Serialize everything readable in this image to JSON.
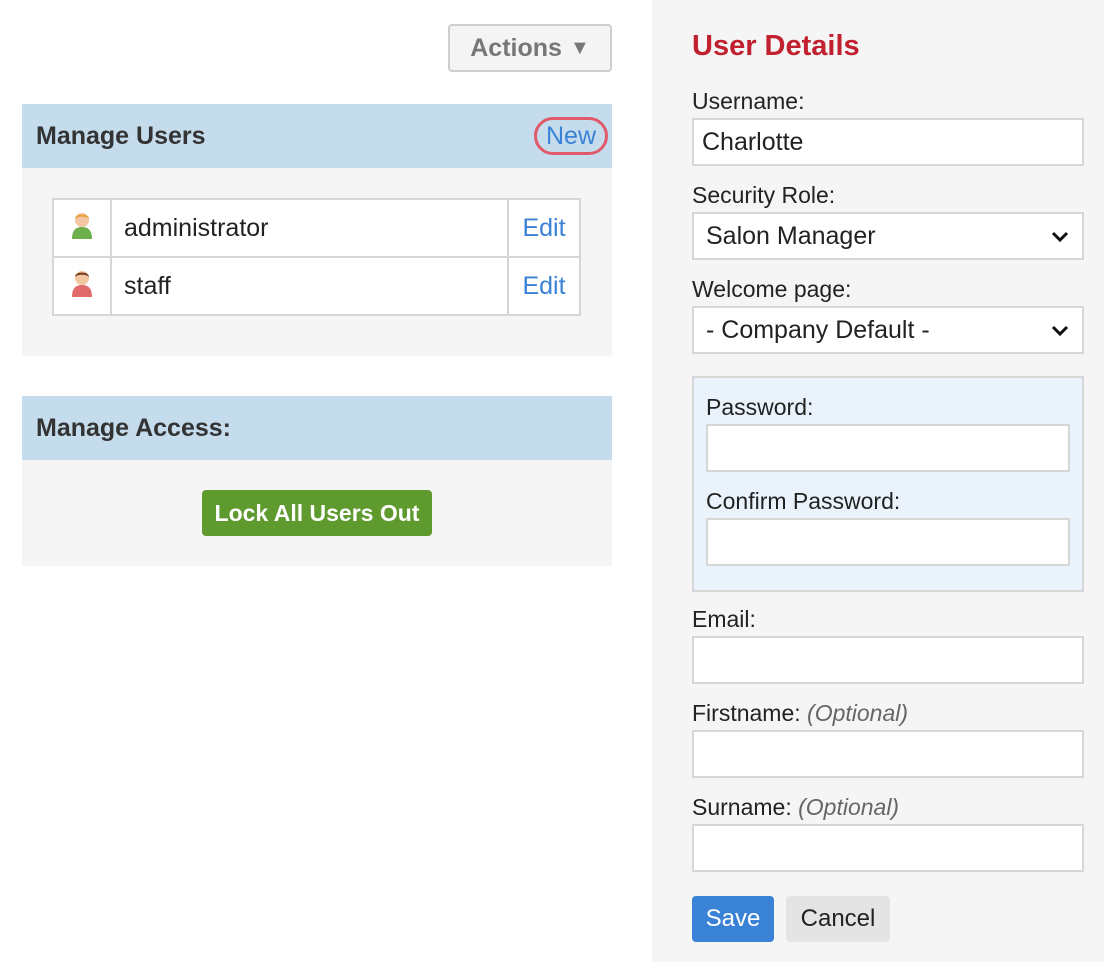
{
  "toolbar": {
    "actions_label": "Actions",
    "actions_caret": "▼"
  },
  "manage_users": {
    "title": "Manage Users",
    "new_label": "New",
    "users": [
      {
        "name": "administrator",
        "edit_label": "Edit",
        "icon": "user-green-icon"
      },
      {
        "name": "staff",
        "edit_label": "Edit",
        "icon": "user-red-icon"
      }
    ]
  },
  "manage_access": {
    "title": "Manage Access:",
    "lock_label": "Lock All Users Out"
  },
  "user_details": {
    "title": "User Details",
    "username_label": "Username:",
    "username_value": "Charlotte",
    "security_role_label": "Security Role:",
    "security_role_value": "Salon Manager",
    "welcome_page_label": "Welcome page:",
    "welcome_page_value": "- Company Default -",
    "password_label": "Password:",
    "confirm_password_label": "Confirm Password:",
    "email_label": "Email:",
    "firstname_label": "Firstname:",
    "surname_label": "Surname:",
    "optional_label": "(Optional)",
    "save_label": "Save",
    "cancel_label": "Cancel"
  },
  "colors": {
    "header_bg": "#c5dcec",
    "link": "#3a82d6",
    "accent_red": "#c1202f",
    "lock_green": "#5e9a2e"
  }
}
